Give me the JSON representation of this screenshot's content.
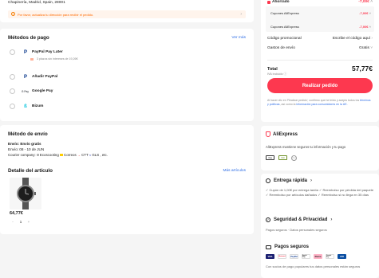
{
  "address": {
    "line": "Chapinería, Madrid, Spain, 28001"
  },
  "notice": {
    "text": "Por favor, actualiza tu dirección para recibir el pedido."
  },
  "payment": {
    "title": "Métodos de pago",
    "more_link": "Ver más",
    "methods": [
      {
        "label": "PayPal Pay Later",
        "icon": "paypal-icon",
        "sub": "3 plazos sin intereses de 19,26€"
      },
      {
        "label": "Añadir PayPal",
        "icon": "paypal-icon"
      },
      {
        "label": "Google Pay",
        "icon": "google-pay-icon",
        "icon_text": "G Pay"
      },
      {
        "label": "Bizum",
        "icon": "bizum-icon"
      }
    ]
  },
  "shipping": {
    "title": "Método de envío",
    "type": "Envío: Envío gratis",
    "date": "Envío: 08 - 10 de JUN",
    "courier_prefix": "Courier company:",
    "couriers": [
      "Ecoscooting",
      "Correos",
      "CTT",
      "GLS",
      "etc."
    ]
  },
  "item": {
    "title": "Detalle del artículo",
    "more_link": "Más artículos",
    "price": "64,77€",
    "qty_minus": "-",
    "qty": "1",
    "qty_plus": "+"
  },
  "summary": {
    "savings_label": "Ahorrado",
    "savings_value": "-7,00€",
    "coupon1_label": "Cupones AliExpress",
    "coupon1_value": "-7,00€",
    "coupon2_label": "Cupones AliExpress",
    "coupon2_value": "-7,00€",
    "promo_label": "Código promocional",
    "promo_action": "Escribe el código aquí",
    "shipping_label": "Gastos de envío",
    "shipping_value": "Gratis",
    "total_label": "Total",
    "total_value": "57,77€",
    "vat_note": "IVA incluido",
    "cta": "Realizar pedido",
    "terms_prefix": "Al hacer clic en 'Realizar pedido', confirmo que he leído y acepto todos los",
    "terms_link": "términos y políticas",
    "terms_mid": ", así como la",
    "terms_link2": "información para consumidores en la UE."
  },
  "trust": {
    "brand": "AliExpress",
    "tagline": "AliExpress mantiene seguros tu información y tu pago",
    "badges": [
      "Visa",
      "ISO",
      "PCI"
    ],
    "fast": {
      "title": "Entrega rápida",
      "items": [
        "Cupón de 1,00€ por entrega tardía",
        "Reembolso por pérdida del paquete",
        "Reembolso por artículos dañados",
        "Reembolso si no llega en 35 días"
      ]
    },
    "security": {
      "title": "Seguridad & Privacidad",
      "text": "Pagos seguros · Datos personales seguros"
    },
    "payments": {
      "title": "Pagos seguros",
      "logos": [
        "VISA",
        "Mastercard",
        "PayPal",
        "Apple Pay",
        "Klarna",
        "Google Pay",
        "JCB"
      ],
      "text": "Con socios de pago populares tus datos personales están seguros"
    }
  },
  "colors": {
    "brand_red": "#fd384f",
    "link_blue": "#2e6de5",
    "paypal_blue": "#003087"
  }
}
